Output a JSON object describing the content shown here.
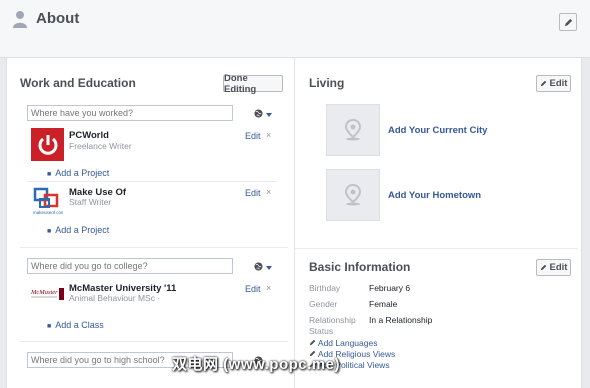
{
  "header": {
    "title": "About"
  },
  "work": {
    "title": "Work and Education",
    "done_label": "Done Editing",
    "workplace_placeholder": "Where have you worked?",
    "college_placeholder": "Where did you go to college?",
    "highschool_placeholder": "Where did you go to high school?",
    "entries": [
      {
        "name": "PCWorld",
        "role": "Freelance Writer",
        "edit": "Edit",
        "add": "Add a Project"
      },
      {
        "name": "Make Use Of",
        "role": "Staff Writer",
        "edit": "Edit",
        "add": "Add a Project"
      }
    ],
    "college": {
      "name": "McMaster University '11",
      "role": "Animal Behaviour MSc ·",
      "edit": "Edit",
      "add": "Add a Class"
    },
    "close_glyph": "×",
    "muo_logo_text": "makeuseof.com",
    "mcm_logo_text": "McMaster"
  },
  "living": {
    "title": "Living",
    "edit_label": "Edit",
    "current_city": "Add Your Current City",
    "hometown": "Add Your Hometown"
  },
  "basic": {
    "title": "Basic Information",
    "edit_label": "Edit",
    "rows": [
      {
        "label": "Birthday",
        "value": "February 6"
      },
      {
        "label": "Gender",
        "value": "Female"
      },
      {
        "label": "Relationship Status",
        "value": "In a Relationship"
      }
    ],
    "add_languages": "Add Languages",
    "add_religious": "Add Religious Views",
    "add_political": "Add Political Views"
  },
  "watermark": "双电网 (www.popc.me)",
  "colors": {
    "link": "#365899",
    "panel": "#ffffff",
    "page": "#e9eaed",
    "pcworld": "#cc2029"
  }
}
